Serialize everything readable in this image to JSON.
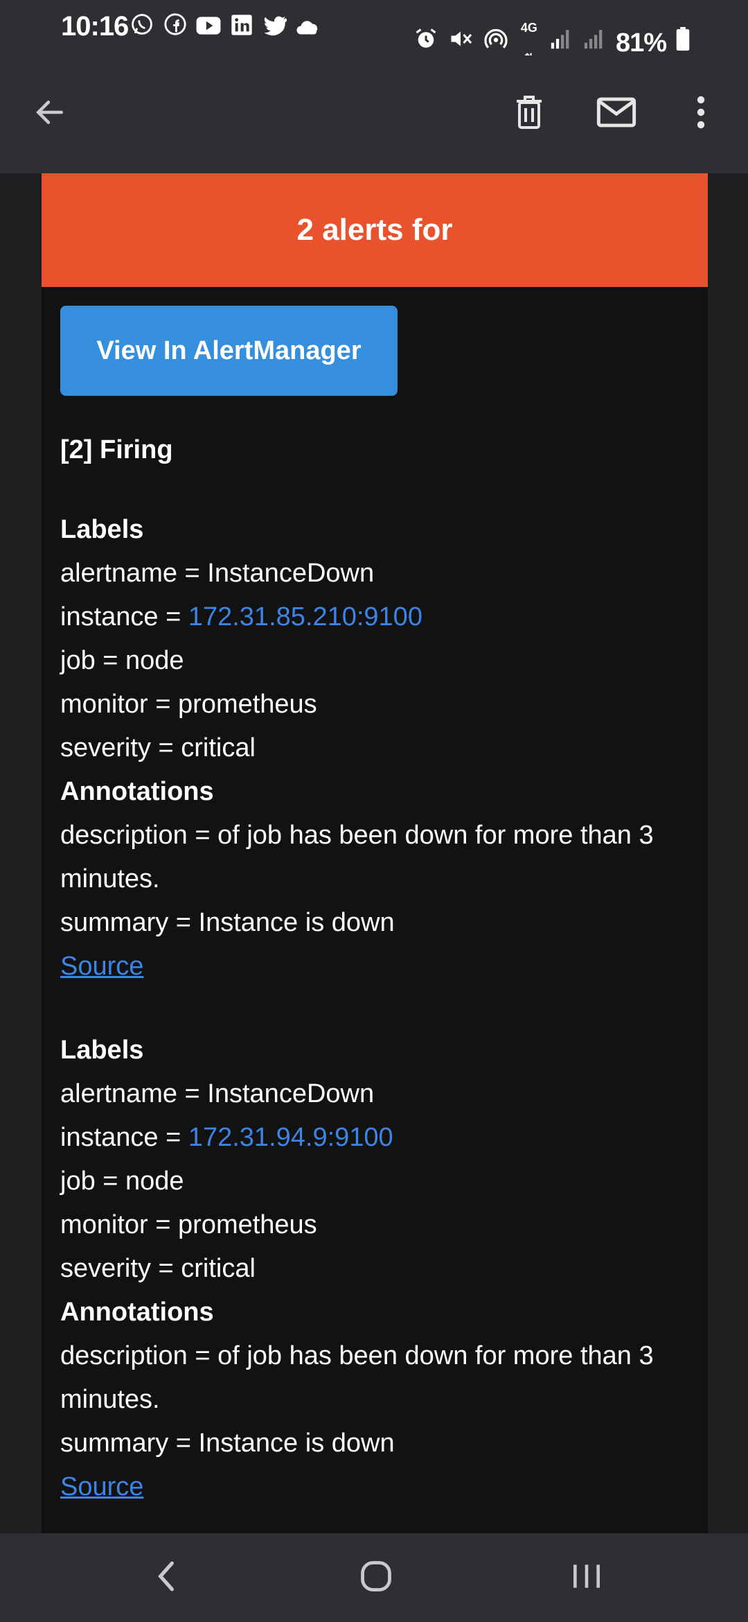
{
  "status_bar": {
    "time": "10:16",
    "left_icons": [
      "whatsapp-icon",
      "facebook-icon",
      "youtube-icon",
      "linkedin-icon",
      "twitter-icon",
      "cloud-icon"
    ],
    "network": "4G",
    "battery": "81%"
  },
  "app_bar": {
    "back_icon": "arrow-left-icon",
    "delete_icon": "trash-icon",
    "mail_icon": "mail-icon",
    "more_icon": "more-vert-icon"
  },
  "email": {
    "banner_title": "2 alerts for",
    "view_button_label": "View In AlertManager",
    "firing_label": "[2] Firing",
    "alerts": [
      {
        "labels_heading": "Labels",
        "alertname_prefix": "alertname = ",
        "alertname": "InstanceDown",
        "instance_prefix": "instance = ",
        "instance": "172.31.85.210:9100",
        "job": "job = node",
        "monitor": "monitor = prometheus",
        "severity": "severity = critical",
        "annotations_heading": "Annotations",
        "description": "description = of job has been down for more than 3 minutes.",
        "summary": "summary = Instance is down",
        "source_link": "Source"
      },
      {
        "labels_heading": "Labels",
        "alertname_prefix": "alertname = ",
        "alertname": "InstanceDown",
        "instance_prefix": "instance = ",
        "instance": "172.31.94.9:9100",
        "job": "job = node",
        "monitor": "monitor = prometheus",
        "severity": "severity = critical",
        "annotations_heading": "Annotations",
        "description": "description = of job has been down for more than 3 minutes.",
        "summary": "summary = Instance is down",
        "source_link": "Source"
      }
    ]
  },
  "colors": {
    "banner": "#e8522d",
    "button": "#368fdc",
    "link": "#3c84e6",
    "background": "#121212"
  }
}
